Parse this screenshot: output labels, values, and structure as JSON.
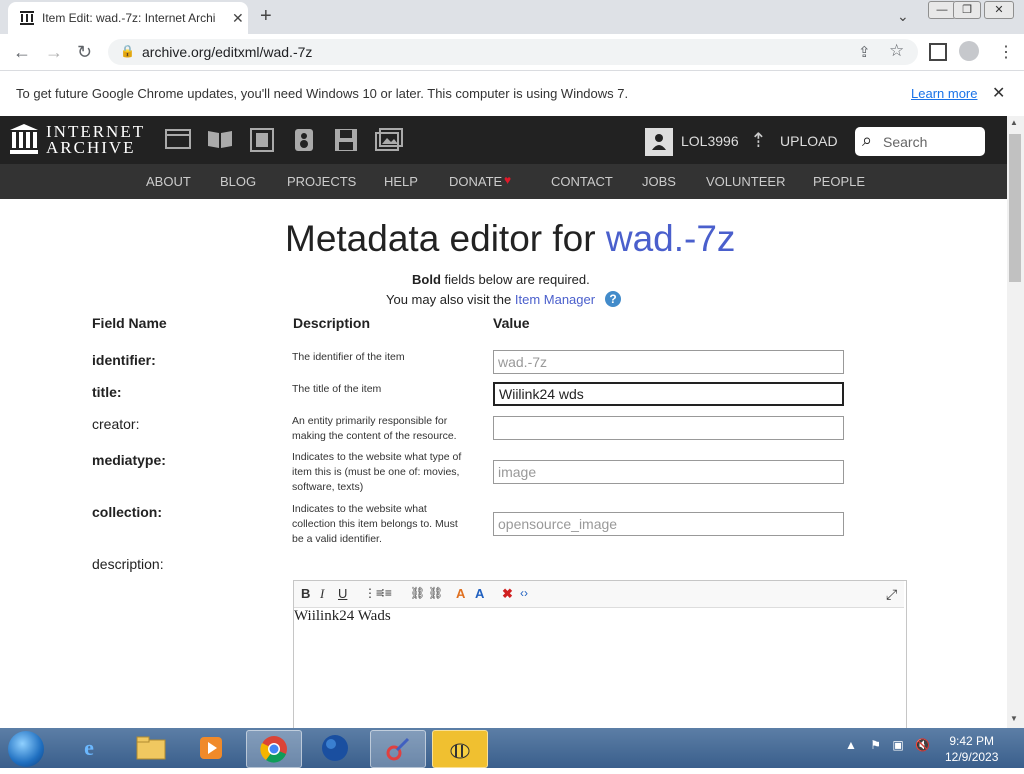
{
  "browser": {
    "tab_title": "Item Edit: wad.-7z: Internet Archi",
    "url": "archive.org/editxml/wad.-7z",
    "infobar_message": "To get future Google Chrome updates, you'll need Windows 10 or later. This computer is using Windows 7.",
    "infobar_link": "Learn more"
  },
  "ia": {
    "logo_line1": "INTERNET",
    "logo_line2": "ARCHIVE",
    "username": "LOL3996",
    "upload_label": "UPLOAD",
    "search_placeholder": "Search",
    "nav": [
      "ABOUT",
      "BLOG",
      "PROJECTS",
      "HELP",
      "DONATE",
      "CONTACT",
      "JOBS",
      "VOLUNTEER",
      "PEOPLE"
    ],
    "donate_heart_color": "#e0192a"
  },
  "page": {
    "title_prefix": "Metadata editor for",
    "title_id": "wad.-7z",
    "required_bold": "Bold",
    "required_rest": " fields below are required.",
    "visit_text": "You may also visit the ",
    "item_manager_link": "Item Manager",
    "help_icon": "?",
    "columns": {
      "field": "Field Name",
      "description": "Description",
      "value": "Value"
    }
  },
  "fields": {
    "identifier": {
      "name": "identifier:",
      "desc": "The identifier of the item",
      "value": "wad.-7z"
    },
    "title": {
      "name": "title:",
      "desc": "The title of the item",
      "value": "Wiilink24 wds"
    },
    "creator": {
      "name": "creator:",
      "desc": "An entity primarily responsible for making the content of the resource.",
      "value": ""
    },
    "mediatype": {
      "name": "mediatype:",
      "desc": "Indicates to the website what type of item this is (must be one of: movies, software, texts)",
      "value": "image"
    },
    "collection": {
      "name": "collection:",
      "desc": "Indicates to the website what collection this item belongs to. Must be a valid identifier.",
      "value": "opensource_image"
    },
    "description": {
      "name": "description:",
      "content": "Wiilink24 Wads"
    }
  },
  "taskbar": {
    "time": "9:42 PM",
    "date": "12/9/2023"
  }
}
